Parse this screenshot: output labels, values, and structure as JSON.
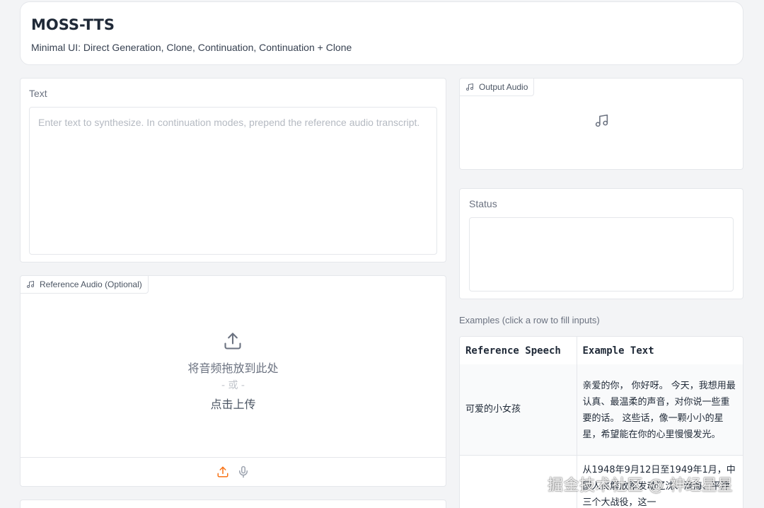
{
  "header": {
    "title": "MOSS-TTS",
    "subtitle": "Minimal UI: Direct Generation, Clone, Continuation, Continuation + Clone"
  },
  "text_input": {
    "label": "Text",
    "placeholder": "Enter text to synthesize. In continuation modes, prepend the reference audio transcript.",
    "value": ""
  },
  "reference_audio": {
    "label": "Reference Audio (Optional)",
    "drop_text": "将音频拖放到此处",
    "or_text": "- 或 -",
    "click_text": "点击上传",
    "icon": "upload-icon",
    "toolbar_icons": [
      "upload-icon",
      "microphone-icon"
    ],
    "accent_color": "#f97316"
  },
  "output_audio": {
    "label": "Output Audio",
    "icon": "music-note-icon"
  },
  "status": {
    "label": "Status",
    "value": ""
  },
  "examples": {
    "label": "Examples (click a row to fill inputs)",
    "columns": [
      "Reference Speech",
      "Example Text"
    ],
    "rows": [
      {
        "reference": "可爱的小女孩",
        "text": "亲爱的你， 你好呀。 今天，我想用最认真、最温柔的声音，对你说一些重要的话。 这些话，像一颗小小的星星，希望能在你的心里慢慢发光。"
      },
      {
        "reference": "",
        "text": "从1948年9月12日至1949年1月，中国人民解放军发动辽沈、淮海、平津三个大战役，这一"
      }
    ]
  },
  "watermark": "掘金技术社区 @ 神经星星"
}
